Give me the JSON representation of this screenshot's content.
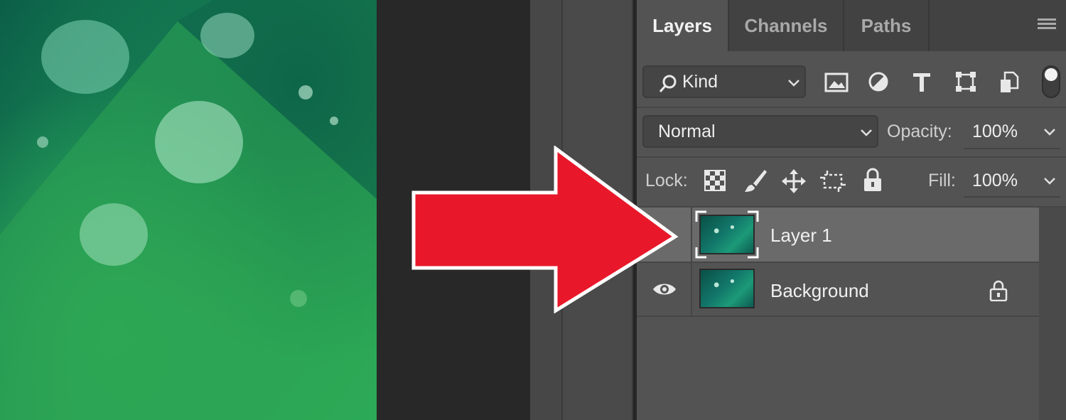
{
  "panel": {
    "tabs": [
      {
        "label": "Layers",
        "active": true
      },
      {
        "label": "Channels",
        "active": false
      },
      {
        "label": "Paths",
        "active": false
      }
    ],
    "filter": {
      "label": "Kind",
      "icons": [
        "image-filter-icon",
        "adjustment-filter-icon",
        "type-filter-icon",
        "shape-filter-icon",
        "smart-object-filter-icon"
      ]
    },
    "blend_mode": "Normal",
    "opacity": {
      "label": "Opacity:",
      "value": "100%"
    },
    "lock": {
      "label": "Lock:",
      "icons": [
        "lock-transparent-icon",
        "lock-image-icon",
        "lock-position-icon",
        "lock-artboard-icon",
        "lock-all-icon"
      ]
    },
    "fill": {
      "label": "Fill:",
      "value": "100%"
    },
    "layers": [
      {
        "name": "Layer 1",
        "selected": true,
        "visible": false,
        "locked": false
      },
      {
        "name": "Background",
        "selected": false,
        "visible": true,
        "locked": true
      }
    ]
  },
  "colors": {
    "arrow": "#e8182a",
    "panel_bg": "#535353",
    "selected_row": "#6a6a6a"
  }
}
